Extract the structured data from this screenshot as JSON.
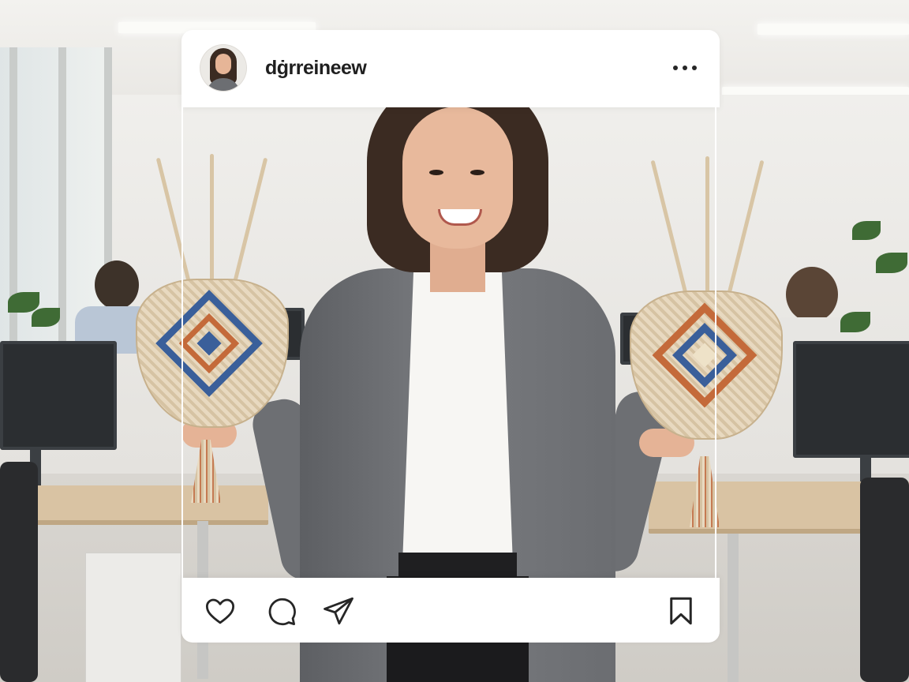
{
  "post": {
    "username": "dġrreineew",
    "more_icon": "more-horizontal-icon"
  },
  "actions": {
    "like_icon": "heart-icon",
    "comment_icon": "comment-icon",
    "share_icon": "send-icon",
    "save_icon": "bookmark-icon"
  },
  "colors": {
    "card": "#ffffff",
    "icon": "#262626",
    "bag_blue": "#3a5f9a",
    "bag_orange": "#c46a3a"
  }
}
